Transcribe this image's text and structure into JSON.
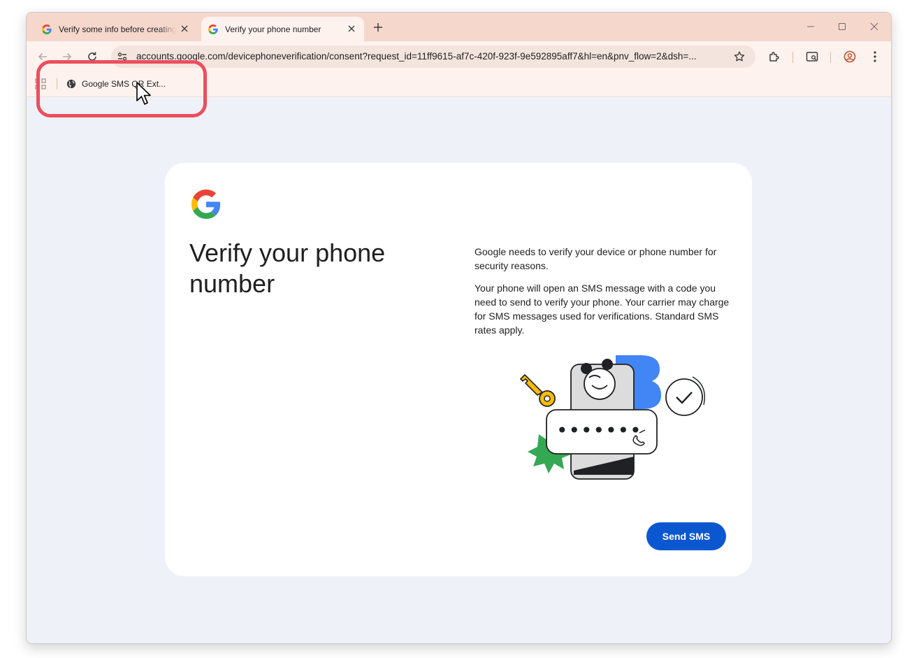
{
  "browser": {
    "tabs": [
      {
        "title": "Verify some info before creating an account",
        "active": false
      },
      {
        "title": "Verify your phone number",
        "active": true
      }
    ],
    "url": "accounts.google.com/devicephoneverification/consent?request_id=11ff9615-af7c-420f-923f-9e592895aff7&hl=en&pnv_flow=2&dsh=...",
    "bookmarks": [
      {
        "label": "Google SMS QR Ext..."
      }
    ],
    "theme_color": "#f6d7cc"
  },
  "page": {
    "heading": "Verify your phone number",
    "paragraphs": [
      "Google needs to verify your device or phone number for security reasons.",
      "Your phone will open an SMS message with a code you need to send to verify your phone. Your carrier may charge for SMS messages used for verifications. Standard SMS rates apply."
    ],
    "illustration": {
      "masked_code": "•••••••"
    },
    "send_button_label": "Send SMS",
    "accent_color": "#0b57d0"
  },
  "annotation": {
    "highlight_color": "#ea4f5e"
  }
}
